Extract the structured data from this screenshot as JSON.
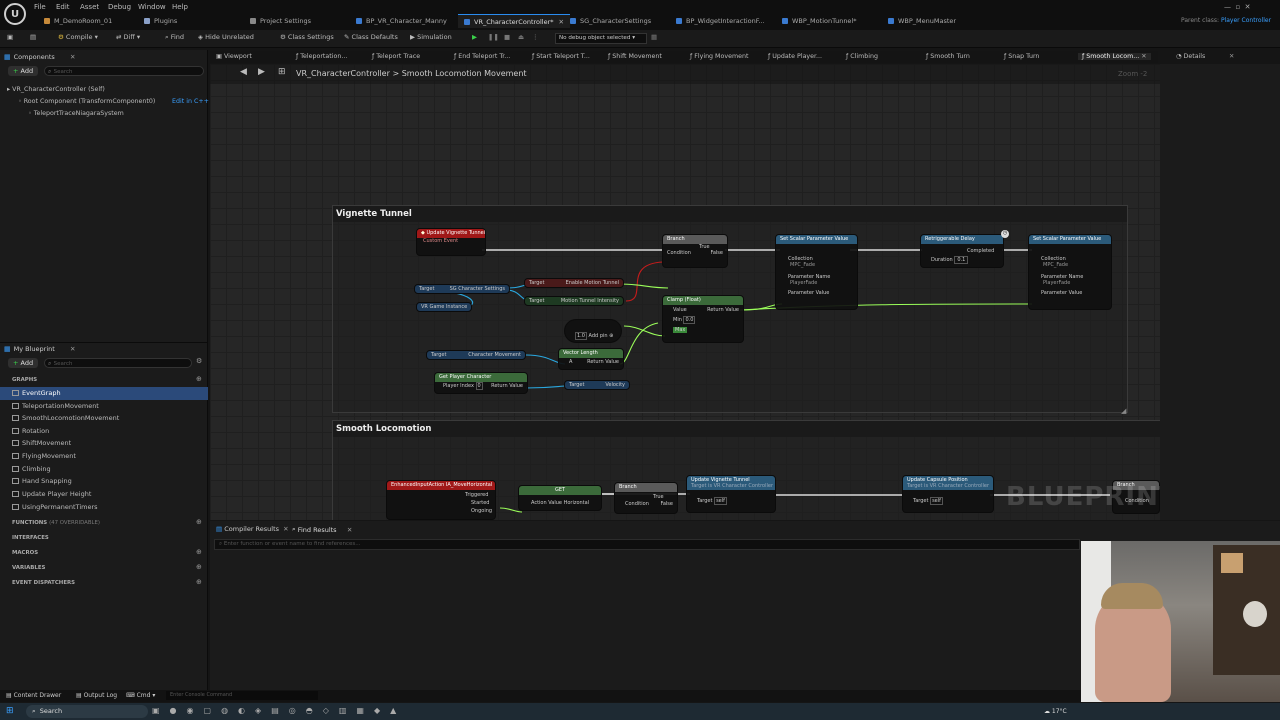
{
  "menubar": {
    "items": [
      "File",
      "Edit",
      "Asset",
      "Debug",
      "Window",
      "Help"
    ],
    "tabs": [
      "M_DemoRoom_01",
      "Plugins",
      "Project Settings",
      "BP_VR_Character_Manny",
      "VR_CharacterController*",
      "SG_CharacterSettings",
      "BP_WidgetInteractionF...",
      "WBP_MotionTunnel*",
      "WBP_MenuMaster"
    ],
    "parent_class_label": "Parent class:",
    "parent_class_value": "Player Controller"
  },
  "toolbar": {
    "compile": "Compile",
    "diff": "Diff",
    "find": "Find",
    "hide_unrelated": "Hide Unrelated",
    "class_settings": "Class Settings",
    "class_defaults": "Class Defaults",
    "simulation": "Simulation",
    "debug_object": "No debug object selected"
  },
  "components": {
    "title": "Components",
    "add": "Add",
    "search_placeholder": "Search",
    "self": "VR_CharacterController (Self)",
    "root": "Root Component (TransformComponent0)",
    "edit_cpp": "Edit in C++",
    "child": "TeleportTraceNiagaraSystem"
  },
  "my_blueprint": {
    "title": "My Blueprint",
    "add": "Add",
    "search_placeholder": "Search",
    "graphs_label": "GRAPHS",
    "graphs": [
      "EventGraph",
      "TeleportationMovement",
      "SmoothLocomotionMovement",
      "Rotation",
      "ShiftMovement",
      "FlyingMovement",
      "Climbing",
      "Hand Snapping",
      "Update Player Height",
      "UsingPermanentTimers"
    ],
    "functions_label": "FUNCTIONS",
    "functions_count": "(47 OVERRIDABLE)",
    "interfaces_label": "INTERFACES",
    "macros_label": "MACROS",
    "variables_label": "VARIABLES",
    "dispatchers_label": "EVENT DISPATCHERS"
  },
  "graph_tabs": [
    "Viewport",
    "Teleportation...",
    "Teleport Trace",
    "End Teleport Tr...",
    "Start Teleport T...",
    "Shift Movement",
    "Flying Movement",
    "Update Player...",
    "Climbing",
    "Smooth Turn",
    "Snap Turn",
    "Smooth Locom..."
  ],
  "details_tab": "Details",
  "breadcrumb": {
    "root": "VR_CharacterController",
    "sep": ">",
    "current": "Smooth Locomotion Movement"
  },
  "zoom": "Zoom -2",
  "comments": {
    "vignette": "Vignette Tunnel",
    "locomotion": "Smooth Locomotion"
  },
  "nodes": {
    "update_vignette": {
      "title": "Update Vignette Tunnel",
      "sub": "Custom Event"
    },
    "branch": {
      "title": "Branch",
      "condition": "Condition",
      "true": "True",
      "false": "False"
    },
    "set_scalar_1": {
      "title": "Set Scalar Parameter Value",
      "collection": "Collection",
      "collection_val": "MPC_Fade",
      "param_name": "Parameter Name",
      "param_name_val": "PlayerFade",
      "param_value": "Parameter Value"
    },
    "delay": {
      "title": "Retriggerable Delay",
      "completed": "Completed",
      "duration": "Duration",
      "duration_val": "0.1"
    },
    "set_scalar_2": {
      "title": "Set Scalar Parameter Value",
      "collection": "Collection",
      "collection_val": "MPC_Fade",
      "param_name": "Parameter Name",
      "param_name_val": "PlayerFade",
      "param_value": "Parameter Value"
    },
    "get_settings": {
      "target": "Target",
      "label": "SG Character Settings"
    },
    "enable_tunnel": {
      "target": "Target",
      "label": "Enable Motion Tunnel"
    },
    "tunnel_intensity": {
      "target": "Target",
      "label": "Motion Tunnel Intensity"
    },
    "game_instance": {
      "label": "VR Game Instance"
    },
    "clamp": {
      "title": "Clamp (Float)",
      "value": "Value",
      "return": "Return Value",
      "min": "Min",
      "min_val": "0.0",
      "max": "Max"
    },
    "add": {
      "label": "Add pin",
      "val": "1.0"
    },
    "char_movement": {
      "target": "Target",
      "label": "Character Movement"
    },
    "vector_length": {
      "title": "Vector Length",
      "a": "A",
      "return": "Return Value"
    },
    "get_velocity": {
      "target": "Target",
      "label": "Velocity"
    },
    "get_player_char": {
      "title": "Get Player Character",
      "index": "Player Index",
      "index_val": "0",
      "return": "Return Value"
    },
    "enhanced_input": {
      "title": "EnhancedInputAction IA_MoveHorizontal",
      "triggered": "Triggered",
      "started": "Started",
      "ongoing": "Ongoing"
    },
    "get_action": {
      "title": "GET",
      "label": "Action Value Horizontal"
    },
    "branch2": {
      "title": "Branch",
      "condition": "Condition",
      "true": "True",
      "false": "False"
    },
    "update_vignette_call": {
      "title": "Update Vignette Tunnel",
      "sub": "Target is VR Character Controller",
      "target": "Target",
      "self": "self"
    },
    "update_capsule": {
      "title": "Update Capsule Position",
      "sub": "Target is VR Character Controller",
      "target": "Target",
      "self": "self"
    },
    "branch3": {
      "title": "Branch",
      "condition": "Condition"
    }
  },
  "watermark": "BLUEPRINT",
  "bottom": {
    "compiler_results": "Compiler Results",
    "find_results": "Find Results",
    "find_placeholder": "Enter function or event name to find references..."
  },
  "statusbar": {
    "content_drawer": "Content Drawer",
    "output_log": "Output Log",
    "cmd": "Cmd",
    "console_placeholder": "Enter Console Command"
  },
  "taskbar": {
    "search": "Search",
    "temp": "17°C"
  },
  "colors": {
    "accent": "#2a8cf0",
    "exec_wire": "#ffffff",
    "float_wire": "#9bff5a",
    "object_wire": "#2aa8e0",
    "event_head": "#a01818",
    "func_head": "#2b5a7a",
    "pure_head": "#3b6a3a"
  }
}
